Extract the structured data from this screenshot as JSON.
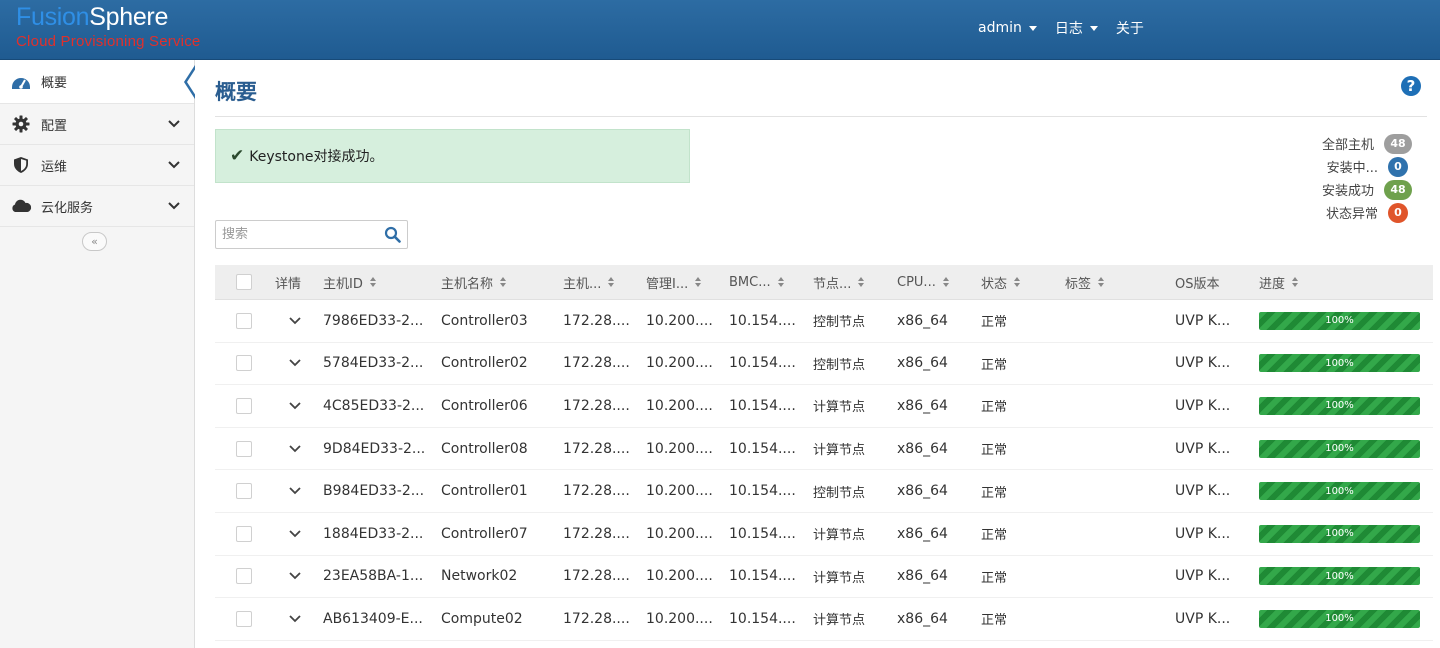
{
  "header": {
    "logo_part1": "Fusion",
    "logo_part2": "Sphere",
    "logo_subtitle": "Cloud Provisioning Service",
    "nav": [
      {
        "label": "admin",
        "dropdown": true
      },
      {
        "label": "日志",
        "dropdown": true
      },
      {
        "label": "关于",
        "dropdown": false
      }
    ]
  },
  "sidebar": {
    "items": [
      {
        "label": "概要",
        "icon": "dashboard-icon",
        "active": true
      },
      {
        "label": "配置",
        "icon": "gear-icon"
      },
      {
        "label": "运维",
        "icon": "shield-icon"
      },
      {
        "label": "云化服务",
        "icon": "cloud-icon"
      }
    ],
    "collapse_label": "«"
  },
  "main": {
    "title": "概要",
    "alert_text": "Keystone对接成功。",
    "search_placeholder": "搜索",
    "stats": [
      {
        "label": "全部主机",
        "count": "48",
        "color": "#9e9e9e"
      },
      {
        "label": "安装中...",
        "count": "0",
        "color": "#2f72ad"
      },
      {
        "label": "安装成功",
        "count": "48",
        "color": "#6fa14d"
      },
      {
        "label": "状态异常",
        "count": "0",
        "color": "#e0552b"
      }
    ],
    "columns": {
      "detail": "详情",
      "host_id": "主机ID",
      "host_name": "主机名称",
      "host_ip": "主机...",
      "mgmt": "管理I...",
      "bmc": "BMC...",
      "role": "节点...",
      "cpu": "CPU...",
      "status": "状态",
      "tags": "标签",
      "os": "OS版本",
      "progress": "进度"
    },
    "rows": [
      {
        "id": "7986ED33-2...",
        "name": "Controller03",
        "ip": "172.28....",
        "mgmt": "10.200....",
        "bmc": "10.154....",
        "role": "控制节点",
        "cpu": "x86_64",
        "status": "正常",
        "os": "UVP K...",
        "progress": "100%"
      },
      {
        "id": "5784ED33-2...",
        "name": "Controller02",
        "ip": "172.28....",
        "mgmt": "10.200....",
        "bmc": "10.154....",
        "role": "控制节点",
        "cpu": "x86_64",
        "status": "正常",
        "os": "UVP K...",
        "progress": "100%"
      },
      {
        "id": "4C85ED33-2...",
        "name": "Controller06",
        "ip": "172.28....",
        "mgmt": "10.200....",
        "bmc": "10.154....",
        "role": "计算节点",
        "cpu": "x86_64",
        "status": "正常",
        "os": "UVP K...",
        "progress": "100%"
      },
      {
        "id": "9D84ED33-2...",
        "name": "Controller08",
        "ip": "172.28....",
        "mgmt": "10.200....",
        "bmc": "10.154....",
        "role": "计算节点",
        "cpu": "x86_64",
        "status": "正常",
        "os": "UVP K...",
        "progress": "100%"
      },
      {
        "id": "B984ED33-2...",
        "name": "Controller01",
        "ip": "172.28....",
        "mgmt": "10.200....",
        "bmc": "10.154....",
        "role": "控制节点",
        "cpu": "x86_64",
        "status": "正常",
        "os": "UVP K...",
        "progress": "100%"
      },
      {
        "id": "1884ED33-2...",
        "name": "Controller07",
        "ip": "172.28....",
        "mgmt": "10.200....",
        "bmc": "10.154....",
        "role": "计算节点",
        "cpu": "x86_64",
        "status": "正常",
        "os": "UVP K...",
        "progress": "100%"
      },
      {
        "id": "23EA58BA-1...",
        "name": "Network02",
        "ip": "172.28....",
        "mgmt": "10.200....",
        "bmc": "10.154....",
        "role": "计算节点",
        "cpu": "x86_64",
        "status": "正常",
        "os": "UVP K...",
        "progress": "100%"
      },
      {
        "id": "AB613409-E...",
        "name": "Compute02",
        "ip": "172.28....",
        "mgmt": "10.200....",
        "bmc": "10.154....",
        "role": "计算节点",
        "cpu": "x86_64",
        "status": "正常",
        "os": "UVP K...",
        "progress": "100%"
      }
    ]
  }
}
